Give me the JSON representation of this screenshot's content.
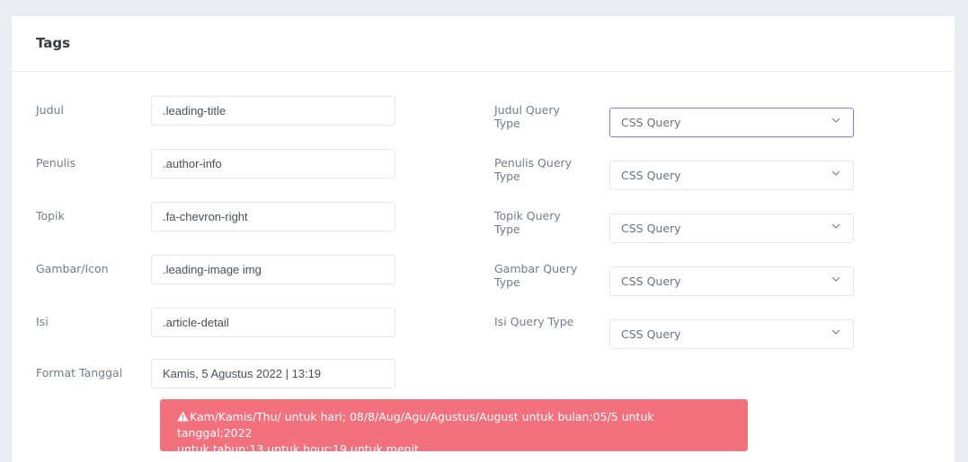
{
  "card": {
    "title": "Tags"
  },
  "left_fields": [
    {
      "label": "Judul",
      "value": ".leading-title"
    },
    {
      "label": "Penulis",
      "value": ".author-info"
    },
    {
      "label": "Topik",
      "value": ".fa-chevron-right"
    },
    {
      "label": "Gambar/Icon",
      "value": ".leading-image img"
    },
    {
      "label": "Isi",
      "value": ".article-detail"
    },
    {
      "label": "Format Tanggal",
      "value": "Kamis, 5 Agustus 2022 | 13:19"
    }
  ],
  "right_fields": [
    {
      "label_line1": "Judul Query",
      "label_line2": "Type",
      "value": "CSS Query",
      "focused": true
    },
    {
      "label_line1": "Penulis Query",
      "label_line2": "Type",
      "value": "CSS Query",
      "focused": false
    },
    {
      "label_line1": "Topik Query",
      "label_line2": "Type",
      "value": "CSS Query",
      "focused": false
    },
    {
      "label_line1": "Gambar Query",
      "label_line2": "Type",
      "value": "CSS Query",
      "focused": false
    },
    {
      "label_line1": "Isi Query Type",
      "label_line2": "",
      "value": "CSS Query",
      "focused": false
    }
  ],
  "alert": {
    "icon": "warning-icon",
    "line1": "Kam/Kamis/Thu/ untuk hari; 08/8/Aug/Agu/Agustus/August untuk bulan;05/5 untuk tanggal;2022",
    "line2": "untuk tahun;13 untuk hour;19 untuk menit"
  },
  "colors": {
    "page_background": "#ecedf2",
    "card_background": "#ffffff",
    "focus_border": "#8a84d6",
    "alert_background": "#f3707d"
  }
}
